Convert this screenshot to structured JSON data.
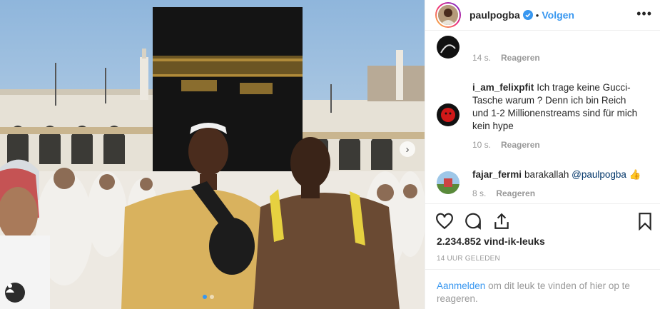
{
  "post": {
    "username": "paulpogba",
    "follow_label": "Volgen",
    "separator": "•",
    "more_label": "•••",
    "likes": "2.234.852 vind-ik-leuks",
    "time_ago": "14 UUR GELEDEN",
    "next_arrow": "›"
  },
  "comments": [
    {
      "username": "",
      "text": "",
      "time": "14 s.",
      "reply_label": "Reageren"
    },
    {
      "username": "i_am_felixpfit",
      "text": "Ich trage keine Gucci-Tasche warum ? Denn ich bin Reich und 1-2 Millionenstreams sind für mich kein hype",
      "time": "10 s.",
      "reply_label": "Reageren"
    },
    {
      "username": "fajar_fermi",
      "text": "barakallah",
      "mention": "@paulpogba",
      "emoji": "👍",
      "time": "8 s.",
      "reply_label": "Reageren"
    }
  ],
  "footer": {
    "login_label": "Aanmelden",
    "text": " om dit leuk te vinden of hier op te reageren."
  },
  "colors": {
    "accent": "#3897f0",
    "mention": "#003569",
    "muted": "#999999"
  },
  "icons": [
    "verified-badge-icon",
    "heart-icon",
    "comment-icon",
    "share-icon",
    "bookmark-icon",
    "user-tag-icon",
    "chevron-right-icon"
  ]
}
